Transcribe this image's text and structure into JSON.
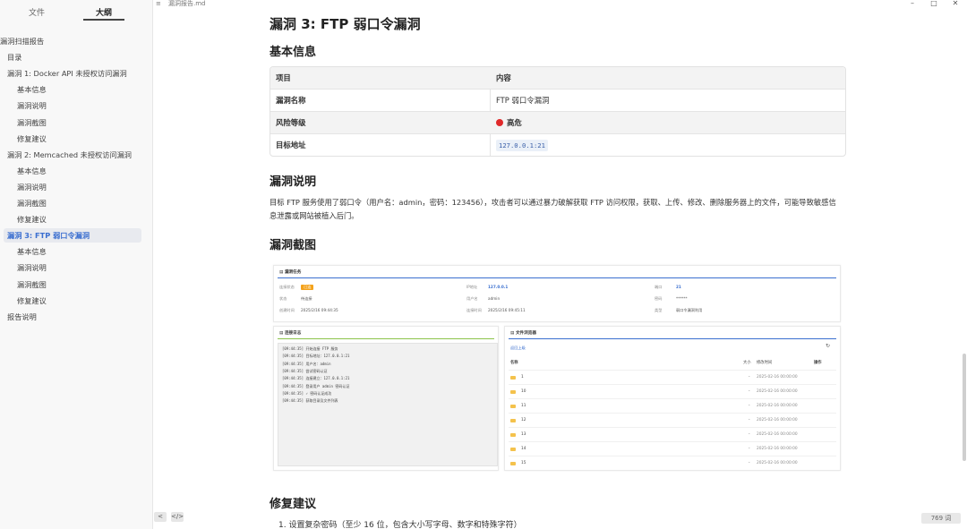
{
  "window": {
    "title": "漏洞报告.md",
    "menu_icon": "≡",
    "minimize": "–",
    "maximize": "□",
    "close": "✕"
  },
  "sidebar": {
    "tabs": [
      {
        "label": "文件"
      },
      {
        "label": "大纲"
      }
    ],
    "active_tab": "大纲",
    "outline": [
      {
        "label": "漏洞扫描报告",
        "level": 0
      },
      {
        "label": "目录",
        "level": 1
      },
      {
        "label": "漏洞 1: Docker API 未授权访问漏洞",
        "level": 1
      },
      {
        "label": "基本信息",
        "level": 2
      },
      {
        "label": "漏洞说明",
        "level": 2
      },
      {
        "label": "漏洞截图",
        "level": 2
      },
      {
        "label": "修复建议",
        "level": 2
      },
      {
        "label": "漏洞 2: Memcached 未授权访问漏洞",
        "level": 1
      },
      {
        "label": "基本信息",
        "level": 2
      },
      {
        "label": "漏洞说明",
        "level": 2
      },
      {
        "label": "漏洞截图",
        "level": 2
      },
      {
        "label": "修复建议",
        "level": 2
      },
      {
        "label": "漏洞 3: FTP 弱口令漏洞",
        "level": 1,
        "active": true
      },
      {
        "label": "基本信息",
        "level": 2
      },
      {
        "label": "漏洞说明",
        "level": 2
      },
      {
        "label": "漏洞截图",
        "level": 2
      },
      {
        "label": "修复建议",
        "level": 2
      },
      {
        "label": "报告说明",
        "level": 1
      }
    ],
    "bottom_buttons": [
      {
        "label": "<",
        "icon": "chevron-left-icon"
      },
      {
        "label": "</>",
        "icon": "code-icon"
      }
    ]
  },
  "document": {
    "heading": "漏洞 3: FTP 弱口令漏洞",
    "basic_info_heading": "基本信息",
    "table": {
      "headers": [
        "项目",
        "内容"
      ],
      "rows": [
        {
          "key": "漏洞名称",
          "value": "FTP 弱口令漏洞"
        },
        {
          "key": "风险等级",
          "value": "高危",
          "status_color": "#e0292a"
        },
        {
          "key": "目标地址",
          "value": "127.0.0.1:21"
        }
      ]
    },
    "description_heading": "漏洞说明",
    "description": "目标 FTP 服务使用了弱口令（用户名：admin，密码：123456），攻击者可以通过暴力破解获取 FTP 访问权限，获取、上传、修改、删除服务器上的文件，可能导致敏感信息泄露或网站被植入后门。",
    "screenshot_heading": "漏洞截图",
    "fix_heading": "修复建议",
    "fix_items": [
      "1. 设置复杂密码（至少 16 位，包含大小写字母、数字和特殊字符）"
    ]
  },
  "screenshot": {
    "task_panel": {
      "title": "漏洞任务",
      "accent": "#3a6fcf",
      "fields": [
        {
          "k": "连接状态",
          "v": "已连",
          "badge": true
        },
        {
          "k": "IP地址",
          "v": "127.0.0.1",
          "blue": true
        },
        {
          "k": "端口",
          "v": "21",
          "blue": true
        },
        {
          "k": "状态",
          "v": "待连接"
        },
        {
          "k": "用户名",
          "v": "admin"
        },
        {
          "k": "密码",
          "v": "******"
        },
        {
          "k": "创建时间",
          "v": "2025/2/16 09:44:35"
        },
        {
          "k": "连接时间",
          "v": "2025/2/16 09:45:11"
        },
        {
          "k": "类型",
          "v": "弱口令漏洞利用"
        }
      ]
    },
    "log_panel": {
      "title": "连接日志",
      "accent": "#8bc34a",
      "lines": [
        "[09:44:35] 开始连接 FTP 服务",
        "[09:44:35] 目标地址：127.0.0.1:21",
        "[09:44:35] 用户名：admin",
        "[09:44:35] 尝试密码认证",
        "[09:44:35] 连接建立：127.0.0.1:21",
        "[09:44:35] 登录用户 admin 密码认证",
        "[09:44:35] ✓ 密码认证成功",
        "[09:44:35] 获取目录及文件列表"
      ]
    },
    "file_panel": {
      "title": "文件浏览器",
      "accent": "#3a6fcf",
      "back_label": "返回上级",
      "refresh_icon": "↻",
      "columns": [
        "名称",
        "大小",
        "修改时间",
        "操作"
      ],
      "rows": [
        {
          "name": "1",
          "size": "-",
          "time": "2025-02-16 00:00:00"
        },
        {
          "name": "10",
          "size": "-",
          "time": "2025-02-16 00:00:00"
        },
        {
          "name": "11",
          "size": "-",
          "time": "2025-02-16 00:00:00"
        },
        {
          "name": "12",
          "size": "-",
          "time": "2025-02-16 00:00:00"
        },
        {
          "name": "13",
          "size": "-",
          "time": "2025-02-16 00:00:00"
        },
        {
          "name": "14",
          "size": "-",
          "time": "2025-02-16 00:00:00"
        },
        {
          "name": "15",
          "size": "-",
          "time": "2025-02-16 00:00:00"
        }
      ]
    }
  },
  "status": {
    "word_count": "769 词"
  }
}
